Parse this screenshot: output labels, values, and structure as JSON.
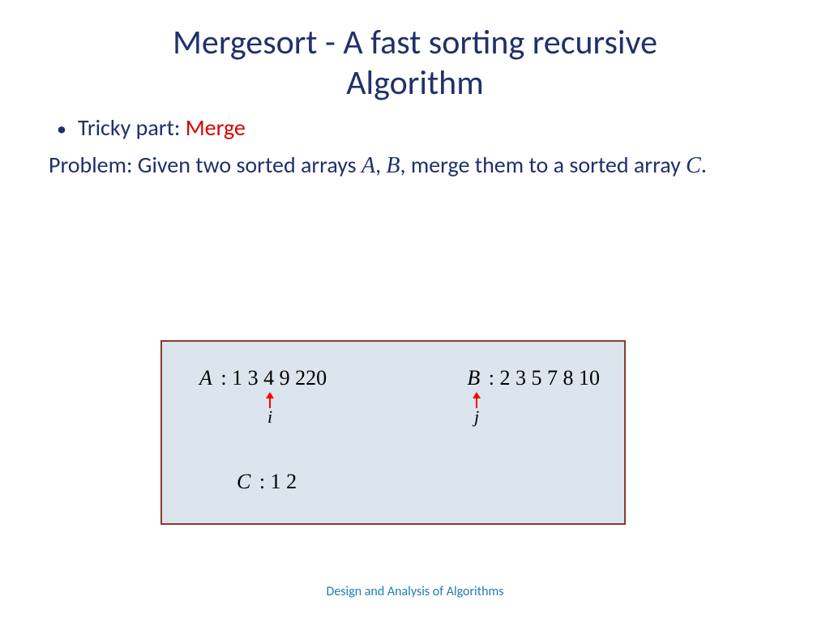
{
  "title_l1": "Mergesort - A fast sorting recursive",
  "title_l2": "Algorithm",
  "bullet": {
    "prefix": "Tricky part: ",
    "highlight": "Merge"
  },
  "problem": {
    "p1": "Problem: Given two sorted arrays ",
    "varA": "A",
    "comma": ", ",
    "varB": "B",
    "p2": ", merge them to a sorted array ",
    "varC": "C",
    "dot": "."
  },
  "diagram": {
    "A_label": "A",
    "A_values": " : 1 3 4 9 220",
    "B_label": "B",
    "B_values": " : 2 3 5 7 8 10",
    "C_label": "C",
    "C_values": " : 1 2",
    "ptr_i": "i",
    "ptr_j": "j",
    "arrow_color": "#ff0000"
  },
  "footer": "Design and Analysis of Algorithms"
}
